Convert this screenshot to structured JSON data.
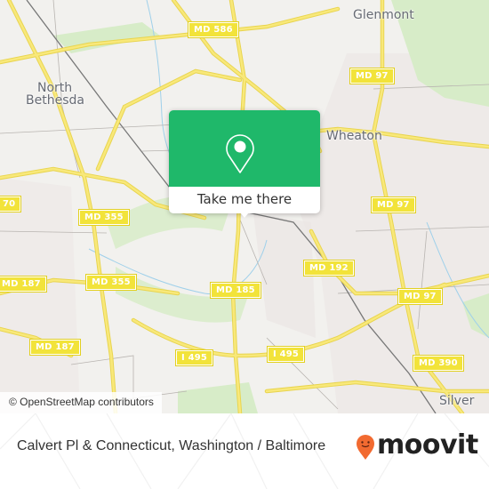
{
  "map": {
    "places": [
      {
        "id": "north-bethesda-1",
        "label": "North"
      },
      {
        "id": "north-bethesda-2",
        "label": "Bethesda"
      },
      {
        "id": "glenmont",
        "label": "Glenmont"
      },
      {
        "id": "wheaton",
        "label": "Wheaton"
      },
      {
        "id": "silver",
        "label": "Silver"
      }
    ],
    "shields": [
      {
        "label": "MD 586"
      },
      {
        "label": "MD 97"
      },
      {
        "label": "70"
      },
      {
        "label": "MD 355"
      },
      {
        "label": "MD 97"
      },
      {
        "label": "MD 187"
      },
      {
        "label": "MD 355"
      },
      {
        "label": "MD 192"
      },
      {
        "label": "MD 185"
      },
      {
        "label": "MD 97"
      },
      {
        "label": "MD 187"
      },
      {
        "label": "I 495"
      },
      {
        "label": "I 495"
      },
      {
        "label": "MD 390"
      }
    ],
    "attribution": "© OpenStreetMap contributors"
  },
  "popup": {
    "icon": "map-pin-icon",
    "button_label": "Take me there",
    "color": "#1fb86a"
  },
  "footer": {
    "title": "Calvert Pl & Connecticut, Washington / Baltimore",
    "brand": "moovit",
    "brand_color": "#f26a30"
  }
}
